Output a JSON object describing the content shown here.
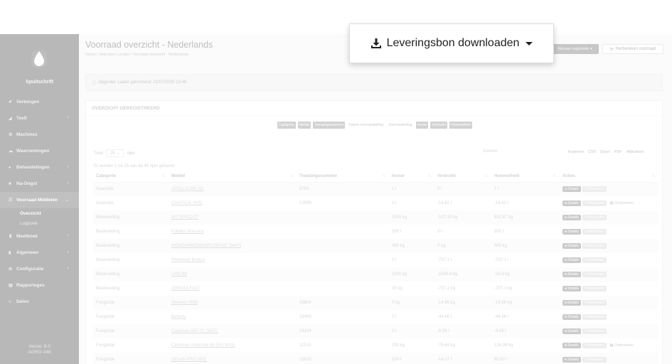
{
  "sidebar": {
    "brand": "Spuitschrift",
    "items": [
      {
        "icon": "✐",
        "label": "Verborgen",
        "chevron": false
      },
      {
        "icon": "◢",
        "label": "Teelt",
        "chevron": true
      },
      {
        "icon": "⚙",
        "label": "Machines",
        "chevron": false
      },
      {
        "icon": "☁",
        "label": "Waarnemingen",
        "chevron": false
      },
      {
        "icon": "♠",
        "label": "Behandelingen",
        "chevron": true
      },
      {
        "icon": "■",
        "label": "Na-Oogst",
        "chevron": true
      },
      {
        "icon": "☰",
        "label": "Voorraad Middelen",
        "chevron": true,
        "active": true
      },
      {
        "icon": "♜",
        "label": "Meetboek",
        "chevron": true
      },
      {
        "icon": "▮",
        "label": "Algemeen",
        "chevron": true
      },
      {
        "icon": "✿",
        "label": "Configuratie",
        "chevron": true
      },
      {
        "icon": "▤",
        "label": "Rapportages",
        "chevron": false
      },
      {
        "icon": "<",
        "label": "Delen",
        "chevron": false
      }
    ],
    "subitems": [
      "Overzicht",
      "Logboek"
    ],
    "version_line1": "Versie: 8.0",
    "version_line2": "AGRO-348"
  },
  "header": {
    "title": "Voorraad overzicht - Nederlands",
    "breadcrumb": "Home  /  Selecteer Locatie  /  Voorraad overzicht - Nederlands",
    "new_button": "Nieuwe registratie ▾",
    "recalc_button": "Herbereken voorraad"
  },
  "info": {
    "text": "Opgeslat: Laatst gerunnend: 21/07/2020 13:48"
  },
  "card": {
    "title": "OVERZICHT GEREGISTREERD",
    "column_toggles": [
      {
        "label": "Categorie",
        "on": true
      },
      {
        "label": "Middel",
        "on": true
      },
      {
        "label": "Toelatingsnummer",
        "on": true
      },
      {
        "label": "Datum voorraadtelling",
        "on": false
      },
      {
        "label": "Voorraadtelling",
        "on": false
      },
      {
        "label": "Invoer",
        "on": true
      },
      {
        "label": "Verbruikt",
        "on": true
      },
      {
        "label": "Hoeveelheid",
        "on": true
      }
    ],
    "toon_label": "Toon",
    "rows_select": "25",
    "rijen_label": "rijen",
    "search_label": "Zoeken:",
    "exports": [
      "Kopieren",
      "CSV",
      "Excel",
      "PDF",
      "Afdrukken"
    ],
    "count_text": "Er worden 1 tot 25 van de 45 rijen getoond"
  },
  "table": {
    "headers": [
      "Categorie",
      "Middel",
      "Toelatingsnummer",
      "Invoer",
      "Verbruikt",
      "Hoeveelheid",
      "Acties"
    ],
    "details_label": "Details",
    "edit_label": "Bewerken",
    "omboeken_label": "Omboeken",
    "rows": [
      {
        "cat": "Acaricide",
        "middel": "APOLLO 500 SC",
        "nr": "8794",
        "invoer": "1 l",
        "verbruikt": "0 l",
        "hoev": "1 l",
        "omb": ""
      },
      {
        "cat": "Acaricide",
        "middel": "CANTACK (WS)",
        "nr": "12939",
        "invoer": "0 l",
        "verbruikt": "-14.62 l",
        "hoev": "-14.62 l",
        "omb": "Omboeken"
      },
      {
        "cat": "Bladvoeding",
        "middel": "BITTERZOUT",
        "nr": "",
        "invoer": "1000 kg",
        "verbruikt": "-107.33 kg",
        "hoev": "892.67 kg",
        "omb": ""
      },
      {
        "cat": "Bladvoeding",
        "middel": "Foliplus Brassica",
        "nr": "",
        "invoer": "500 l",
        "verbruikt": "0 l",
        "hoev": "500 l",
        "omb": ""
      },
      {
        "cat": "Bladvoeding",
        "middel": "MONOAMMONIUMFOSFAAT (MAP)",
        "nr": "",
        "invoer": "400 kg",
        "verbruikt": "0 kg",
        "hoev": "400 kg",
        "omb": ""
      },
      {
        "cat": "Bladvoeding",
        "middel": "Powerleaf Borium",
        "nr": "",
        "invoer": "0 l",
        "verbruikt": "-737.1 l",
        "hoev": "-737.1 l",
        "omb": ""
      },
      {
        "cat": "Bladvoeding",
        "middel": "UREUM",
        "nr": "",
        "invoer": "1000 kg",
        "verbruikt": "-1059.8 kg",
        "hoev": "-59.8 kg",
        "omb": ""
      },
      {
        "cat": "Bladvoeding",
        "middel": "ZINKSULFAAT",
        "nr": "",
        "invoer": "30 kg",
        "verbruikt": "-737.1 kg",
        "hoev": "-707.1 kg",
        "omb": ""
      },
      {
        "cat": "Fungicide",
        "middel": "Abiuban (WB)",
        "nr": "16804",
        "invoer": "0 kg",
        "verbruikt": "-14.96 kg",
        "hoev": "-14.96 kg",
        "omb": ""
      },
      {
        "cat": "Fungicide",
        "middel": "Belanty",
        "nr": "16459",
        "invoer": "0 l",
        "verbruikt": "-44.56 l",
        "hoev": "-44.56 l",
        "omb": ""
      },
      {
        "cat": "Fungicide",
        "middel": "Captosan 500 SC (W17)",
        "nr": "16104",
        "invoer": "0 l",
        "verbruikt": "-8.06 l",
        "hoev": "-8.06 l",
        "omb": ""
      },
      {
        "cat": "Fungicide",
        "middel": "Carbonan ondicone 88 (RG W52)",
        "nr": "11515",
        "invoer": "200 kg",
        "verbruikt": "-75.64 kg",
        "hoev": "124.36 kg",
        "omb": "Omboeken"
      },
      {
        "cat": "Fungicide",
        "middel": "DELAN PRO (W2)",
        "nr": "15623",
        "invoer": "100 l",
        "verbruikt": "-14.17 l",
        "hoev": "85.83 l",
        "omb": ""
      }
    ]
  },
  "popup": {
    "label": "Leveringsbon downloaden"
  },
  "colors": {
    "sidebar": "#444444",
    "accent": "#777777"
  }
}
